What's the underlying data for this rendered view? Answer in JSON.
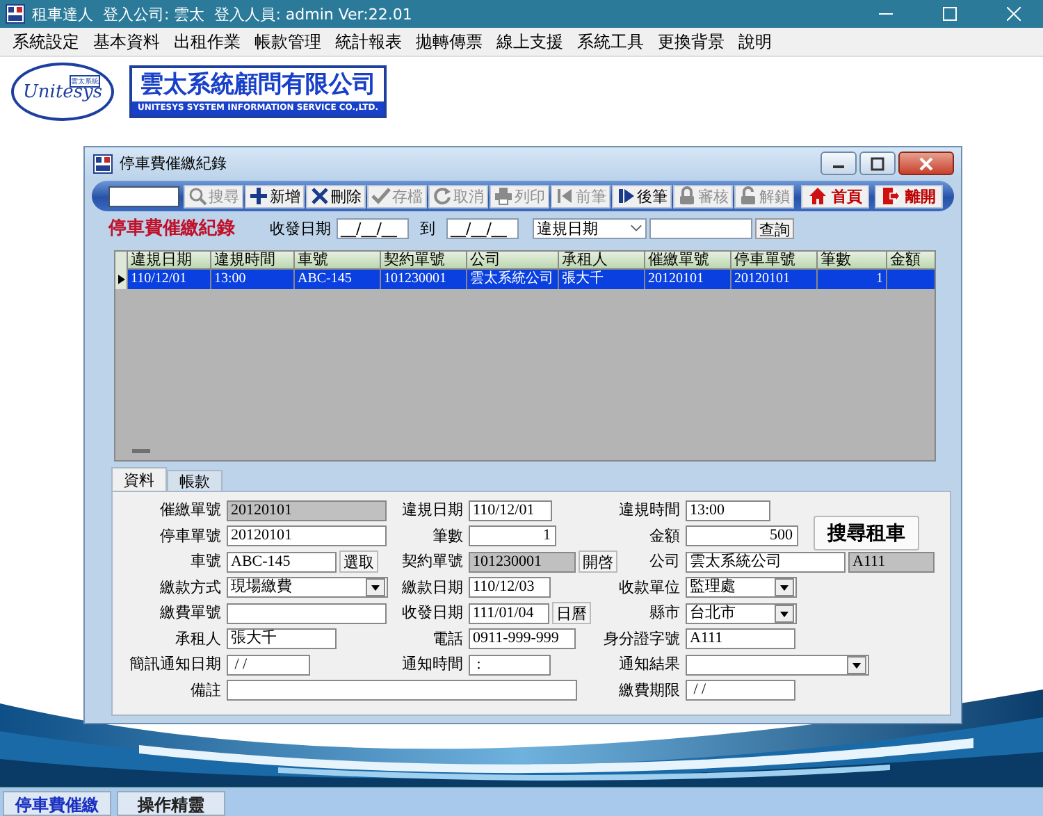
{
  "app_window": {
    "title": "租車達人  登入公司: 雲太  登入人員: admin Ver:22.01"
  },
  "menu": [
    "系統設定",
    "基本資料",
    "出租作業",
    "帳款管理",
    "統計報表",
    "拋轉傳票",
    "線上支援",
    "系統工具",
    "更換背景",
    "說明"
  ],
  "logo": {
    "badge_text": "雲太系統",
    "script_text": "Unitesys",
    "company_name": "雲太系統顧問有限公司",
    "company_english": "UNITESYS SYSTEM INFORMATION SERVICE CO.,LTD."
  },
  "form_window": {
    "title": "停車費催繳紀錄"
  },
  "toolbar": {
    "buttons": [
      {
        "label": "搜尋",
        "disabled": true
      },
      {
        "label": "新增",
        "disabled": false
      },
      {
        "label": "刪除",
        "disabled": false
      },
      {
        "label": "存檔",
        "disabled": true
      },
      {
        "label": "取消",
        "disabled": true
      },
      {
        "label": "列印",
        "disabled": true
      },
      {
        "label": "前筆",
        "disabled": true
      },
      {
        "label": "後筆",
        "disabled": false
      },
      {
        "label": "審核",
        "disabled": true
      },
      {
        "label": "解鎖",
        "disabled": true
      }
    ],
    "nav_buttons": [
      {
        "label": "首頁"
      },
      {
        "label": "離開"
      }
    ]
  },
  "query": {
    "heading": "停車費催繳紀錄",
    "date_label": "收發日期",
    "date_from": "__/__/__",
    "to_label": "到",
    "date_to": "__/__/__",
    "field_select": "違規日期",
    "query_button": "查詢"
  },
  "grid": {
    "columns": [
      "違規日期",
      "違規時間",
      "車號",
      "契約單號",
      "公司",
      "承租人",
      "催繳單號",
      "停車單號",
      "筆數",
      "金額"
    ],
    "rows": [
      {
        "selected": true,
        "cells": [
          "110/12/01",
          "13:00",
          "ABC-145",
          "101230001",
          "雲太系統公司",
          "張大千",
          "20120101",
          "20120101",
          "1",
          ""
        ]
      }
    ]
  },
  "tabs": [
    {
      "label": "資料",
      "selected": true
    },
    {
      "label": "帳款",
      "selected": false
    }
  ],
  "form": {
    "search_button": "搜尋租車",
    "rows": [
      {
        "left": {
          "label": "催繳單號",
          "value": "20120101",
          "kind": "readonly"
        },
        "middle": {
          "label": "違規日期",
          "value": "110/12/01",
          "kind": "text"
        },
        "right": {
          "label": "違規時間",
          "value": "13:00",
          "kind": "text"
        }
      },
      {
        "left": {
          "label": "停車單號",
          "value": "20120101",
          "kind": "text"
        },
        "middle": {
          "label": "筆數",
          "value": "1",
          "kind": "number"
        },
        "right": {
          "label": "金額",
          "value": "500",
          "kind": "number"
        }
      },
      {
        "left": {
          "label": "車號",
          "value": "ABC-145",
          "kind": "text",
          "button": "選取"
        },
        "middle": {
          "label": "契約單號",
          "value": "101230001",
          "kind": "readonly",
          "button": "開啓"
        },
        "right": {
          "label": "公司",
          "value": "雲太系統公司",
          "kind": "text",
          "code": "A111"
        }
      },
      {
        "left": {
          "label": "繳款方式",
          "value": "現場繳費",
          "kind": "dropdown"
        },
        "middle": {
          "label": "繳款日期",
          "value": "110/12/03",
          "kind": "text"
        },
        "right": {
          "label": "收款單位",
          "value": "監理處",
          "kind": "dropdown"
        }
      },
      {
        "left": {
          "label": "繳費單號",
          "kind": "text"
        },
        "middle": {
          "label": "收發日期",
          "value": "111/01/04",
          "kind": "text",
          "button": "日曆"
        },
        "right": {
          "label": "縣市",
          "value": "台北市",
          "kind": "dropdown"
        }
      },
      {
        "left": {
          "label": "承租人",
          "value": "張大千",
          "kind": "text"
        },
        "middle": {
          "label": "電話",
          "value": "0911-999-999",
          "kind": "text"
        },
        "right": {
          "label": "身分證字號",
          "value": "A111",
          "kind": "text"
        }
      },
      {
        "left": {
          "label": "簡訊通知日期",
          "value": " / /",
          "kind": "text"
        },
        "middle": {
          "label": "通知時間",
          "value": " :",
          "kind": "text"
        },
        "right": {
          "label": "通知結果",
          "kind": "dropdown"
        }
      },
      {
        "left": {
          "label": "備註",
          "kind": "wide_text"
        },
        "right": {
          "label": "繳費期限",
          "value": " / /",
          "kind": "text"
        }
      }
    ]
  },
  "taskbar": [
    {
      "label": "停車費催繳",
      "selected": true
    },
    {
      "label": "操作精靈",
      "selected": false
    }
  ]
}
